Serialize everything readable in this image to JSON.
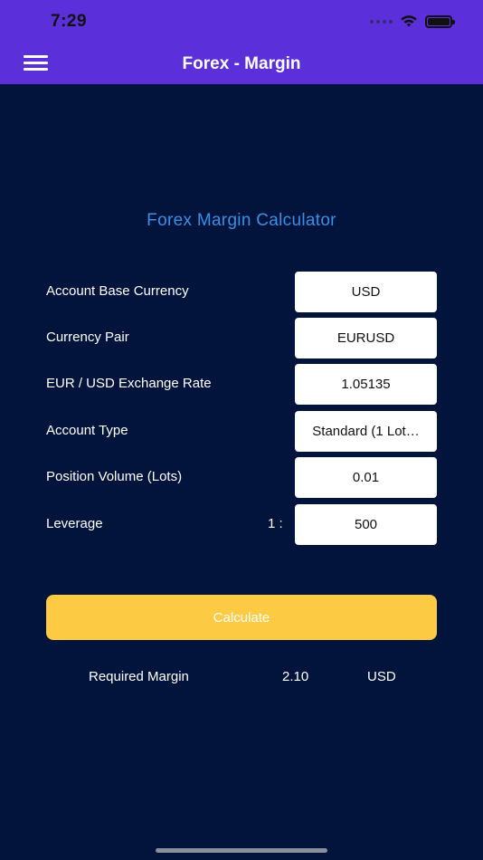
{
  "status": {
    "time": "7:29"
  },
  "header": {
    "title": "Forex - Margin"
  },
  "calculator": {
    "title": "Forex Margin Calculator",
    "rows": [
      {
        "label": "Account Base Currency",
        "value": "USD"
      },
      {
        "label": "Currency Pair",
        "value": "EURUSD"
      },
      {
        "label": "EUR / USD Exchange Rate",
        "value": "1.05135"
      },
      {
        "label": "Account Type",
        "value": "Standard (1 Lot…"
      },
      {
        "label": "Position Volume (Lots)",
        "value": "0.01"
      },
      {
        "label": "Leverage",
        "value": "500"
      }
    ],
    "leverage_prefix": "1 :",
    "calculate_label": "Calculate",
    "result": {
      "label": "Required Margin",
      "value": "2.10",
      "currency": "USD"
    }
  },
  "colors": {
    "header_bg": "#5b2fd9",
    "page_bg": "#03143c",
    "title_accent": "#3a8fe6",
    "button_bg": "#fdcb43"
  }
}
